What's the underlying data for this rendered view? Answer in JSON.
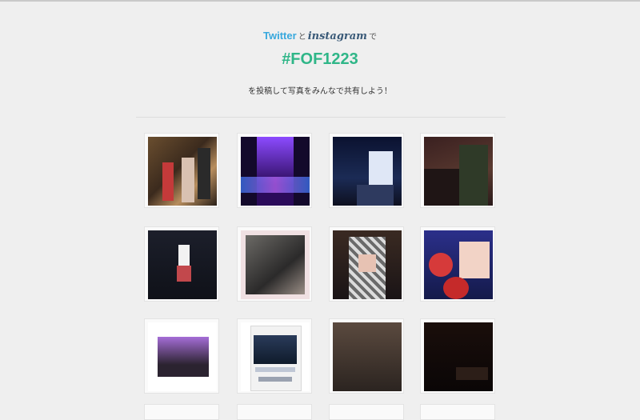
{
  "header": {
    "twitter_brand": "Twitter",
    "connector": "と",
    "instagram_brand": "instagram",
    "suffix": "で",
    "hashtag": "#FOF1223",
    "subtitle": "を投稿して写真をみんなで共有しよう！"
  },
  "colors": {
    "background": "#efefef",
    "twitter_blue": "#38a8dd",
    "hashtag_green": "#2fb688",
    "instagram_text": "#3a5a78"
  },
  "photo_grid": {
    "rows_visible": 3,
    "columns": 4,
    "items": [
      {
        "name": "photo-tile-1"
      },
      {
        "name": "photo-tile-2"
      },
      {
        "name": "photo-tile-3"
      },
      {
        "name": "photo-tile-4"
      },
      {
        "name": "photo-tile-5"
      },
      {
        "name": "photo-tile-6"
      },
      {
        "name": "photo-tile-7"
      },
      {
        "name": "photo-tile-8"
      },
      {
        "name": "photo-tile-9"
      },
      {
        "name": "photo-tile-10"
      },
      {
        "name": "photo-tile-11"
      },
      {
        "name": "photo-tile-12"
      }
    ]
  }
}
